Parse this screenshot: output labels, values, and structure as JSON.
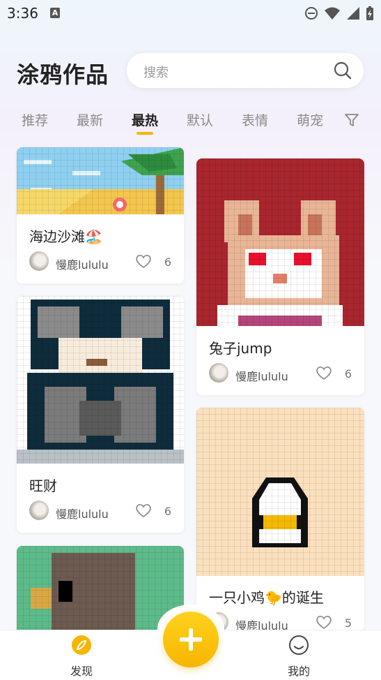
{
  "status_bar": {
    "time": "3:36",
    "notification_letter": "A"
  },
  "header": {
    "title": "涂鸦作品",
    "search_placeholder": "搜索"
  },
  "tabs": [
    {
      "label": "推荐",
      "active": false
    },
    {
      "label": "最新",
      "active": false
    },
    {
      "label": "最热",
      "active": true
    },
    {
      "label": "默认",
      "active": false
    },
    {
      "label": "表情",
      "active": false
    },
    {
      "label": "萌宠",
      "active": false
    }
  ],
  "cards": [
    {
      "title": "海边沙滩🏖️",
      "author": "慢鹿lululu",
      "likes": "6"
    },
    {
      "title": "兔子jump",
      "author": "慢鹿lululu",
      "likes": "6"
    },
    {
      "title": "旺财",
      "author": "慢鹿lululu",
      "likes": "6"
    },
    {
      "title": "一只小鸡🐤的诞生",
      "author": "慢鹿lululu",
      "likes": "5"
    },
    {
      "title": "",
      "author": "",
      "likes": ""
    }
  ],
  "bottom_nav": {
    "discover_label": "发现",
    "mine_label": "我的",
    "accent": "#f7b500"
  },
  "colors": {
    "accent": "#f7b500",
    "background": "#f7f8fb"
  }
}
